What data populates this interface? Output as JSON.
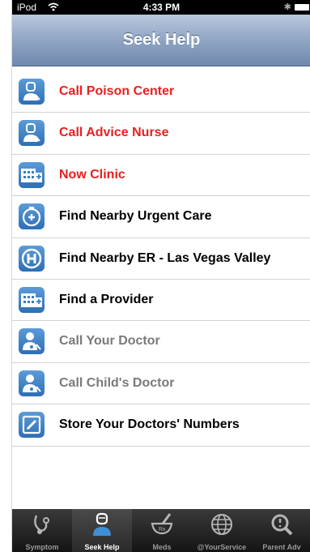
{
  "status_bar": {
    "carrier": "iPod",
    "time": "4:33 PM"
  },
  "nav": {
    "title": "Seek Help"
  },
  "list": {
    "items": [
      {
        "label": "Call Poison Center",
        "icon": "nurse-phone-icon",
        "color": "#e8201f"
      },
      {
        "label": "Call Advice Nurse",
        "icon": "nurse-phone-icon",
        "color": "#e8201f"
      },
      {
        "label": "Now Clinic",
        "icon": "clinic-building-icon",
        "color": "#e8201f"
      },
      {
        "label": "Find Nearby Urgent Care",
        "icon": "urgent-care-icon",
        "color": "#000000"
      },
      {
        "label": "Find Nearby ER - Las Vegas Valley",
        "icon": "hospital-h-icon",
        "color": "#000000"
      },
      {
        "label": "Find a Provider",
        "icon": "clinic-building-icon",
        "color": "#000000"
      },
      {
        "label": "Call Your Doctor",
        "icon": "doctor-phone-icon",
        "color": "#7a7a7a"
      },
      {
        "label": "Call Child's Doctor",
        "icon": "doctor-phone-icon",
        "color": "#7a7a7a"
      },
      {
        "label": "Store Your Doctors' Numbers",
        "icon": "edit-note-icon",
        "color": "#000000"
      }
    ]
  },
  "tab_bar": {
    "tabs": [
      {
        "label": "Symptom",
        "icon": "stethoscope-icon",
        "active": false
      },
      {
        "label": "Seek Help",
        "icon": "nurse-icon",
        "active": true
      },
      {
        "label": "Meds",
        "icon": "mortar-pestle-icon",
        "active": false
      },
      {
        "label": "@YourService",
        "icon": "globe-icon",
        "active": false
      },
      {
        "label": "Parent Adv",
        "icon": "magnifier-icon",
        "active": false
      }
    ]
  }
}
